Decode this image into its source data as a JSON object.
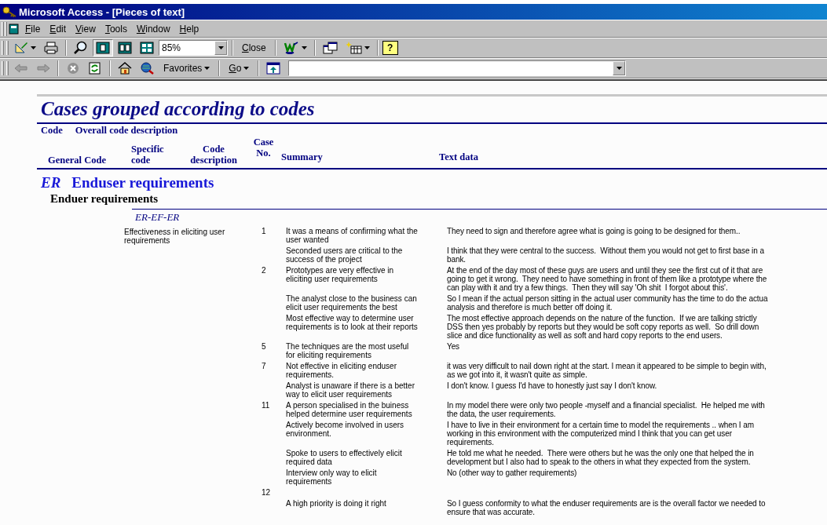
{
  "window": {
    "title": "Microsoft Access - [Pieces of text]"
  },
  "menu": [
    {
      "label": "File",
      "mnemonic": true
    },
    {
      "label": "Edit",
      "mnemonic": true
    },
    {
      "label": "View",
      "mnemonic": true
    },
    {
      "label": "Tools",
      "mnemonic": true
    },
    {
      "label": "Window",
      "mnemonic": true
    },
    {
      "label": "Help",
      "mnemonic": true
    }
  ],
  "toolbar": {
    "page_views": [
      {
        "selected": true
      },
      {
        "selected": false
      },
      {
        "selected": false
      }
    ],
    "zoom": {
      "value": "85%"
    },
    "close_button": {
      "label": "Close",
      "mnemonic": true
    },
    "help_button": {
      "label": "?"
    }
  },
  "web_toolbar": {
    "back": {
      "disabled": true
    },
    "forward": {
      "disabled": true
    },
    "stop": {
      "disabled": true
    },
    "refresh": {
      "disabled": false
    },
    "favorites": {
      "label": "Favorites",
      "mnemonic": false
    },
    "go": {
      "label": "Go",
      "mnemonic": true
    }
  },
  "report": {
    "title": "Cases grouped according to codes",
    "header_top": [
      "Code",
      "Overall code description"
    ],
    "columns": [
      "General Code",
      "Specific code",
      "Code description",
      "Case No.",
      "Summary",
      "Text data"
    ],
    "groups": [
      {
        "code": "ER",
        "description": "Enduser requirements",
        "general": [
          {
            "label": "Enduer requirements",
            "codes": [
              {
                "code": "ER-EF-ER",
                "description": "Effectiveness in eliciting user requirements",
                "rows": [
                  {
                    "case": "1",
                    "summary": "It was a means of confirming what the\nuser wanted",
                    "text": "They need to sign and therefore agree what is going is going to be designed for them.."
                  },
                  {
                    "summary": "Seconded users are critical to the\nsuccess of the project",
                    "text": "I think that they were central to the success.  Without them you would not get to first base in a\nbank."
                  },
                  {
                    "case": "2",
                    "summary": "Prototypes are very effective in\neliciting user requirements",
                    "text": "At the end of the day most of these guys are users and until they see the first cut of it that are\ngoing to get it wrong.  They need to have something in front of them like a prototype where the\ncan play with it and try a few things.  Then they will say 'Oh shit  I forgot about this'."
                  },
                  {
                    "summary": "The analyst close to the business can\nelicit user requirements the best",
                    "text": "So I mean if the actual person sitting in the actual user community has the time to do the actua\nanalysis and therefore is much better off doing it."
                  },
                  {
                    "summary": "Most effective way to determine user\nrequirements is to look at their reports",
                    "text": "The most effective approach depends on the nature of the function.  If we are talking strictly\nDSS then yes probably by reports but they would be soft copy reports as well.  So drill down\nslice and dice functionality as well as soft and hard copy reports to the end users."
                  },
                  {
                    "case": "5",
                    "summary": "The techniques are the most useful\nfor eliciting requirements",
                    "text": "Yes"
                  },
                  {
                    "case": "7",
                    "summary": "Not effective in eliciting enduser\nrequirements.",
                    "text": "it was very difficult to nail down right at the start. I mean it appeared to be simple to begin with,\nas we got into it, it wasn't quite as simple."
                  },
                  {
                    "summary": "Analyst is unaware if there is a better\nway to elicit user requirements",
                    "text": "I don't know. I guess I'd have to honestly just say I don't know."
                  },
                  {
                    "case": "11",
                    "summary": "A person specialised in the buiness\nhelped determine user requirements",
                    "text": "In my model there were only two people -myself and a financial specialist.  He helped me with\nthe data, the user requirements."
                  },
                  {
                    "summary": "Actively become involved in users\nenvironment.",
                    "text": "I have to live in their environment for a certain time to model the requirements .. when I am\nworking in this environment with the computerized mind I think that you can get user\nrequirements."
                  },
                  {
                    "summary": "Spoke to users to effectively elicit\nrequired data",
                    "text": "He told me what he needed.  There were others but he was the only one that helped the in\ndevelopment but I also had to speak to the others in what they expected from the system."
                  },
                  {
                    "summary": "Interview only way to elicit\nrequirements",
                    "text": "No (other way to gather requirements)"
                  },
                  {
                    "case": "12"
                  },
                  {
                    "summary": "A high priority is doing it right",
                    "text": "So I guess conformity to what the enduser requirements are is the overall factor we needed to\nensure that was accurate."
                  }
                ]
              }
            ]
          }
        ]
      }
    ]
  }
}
